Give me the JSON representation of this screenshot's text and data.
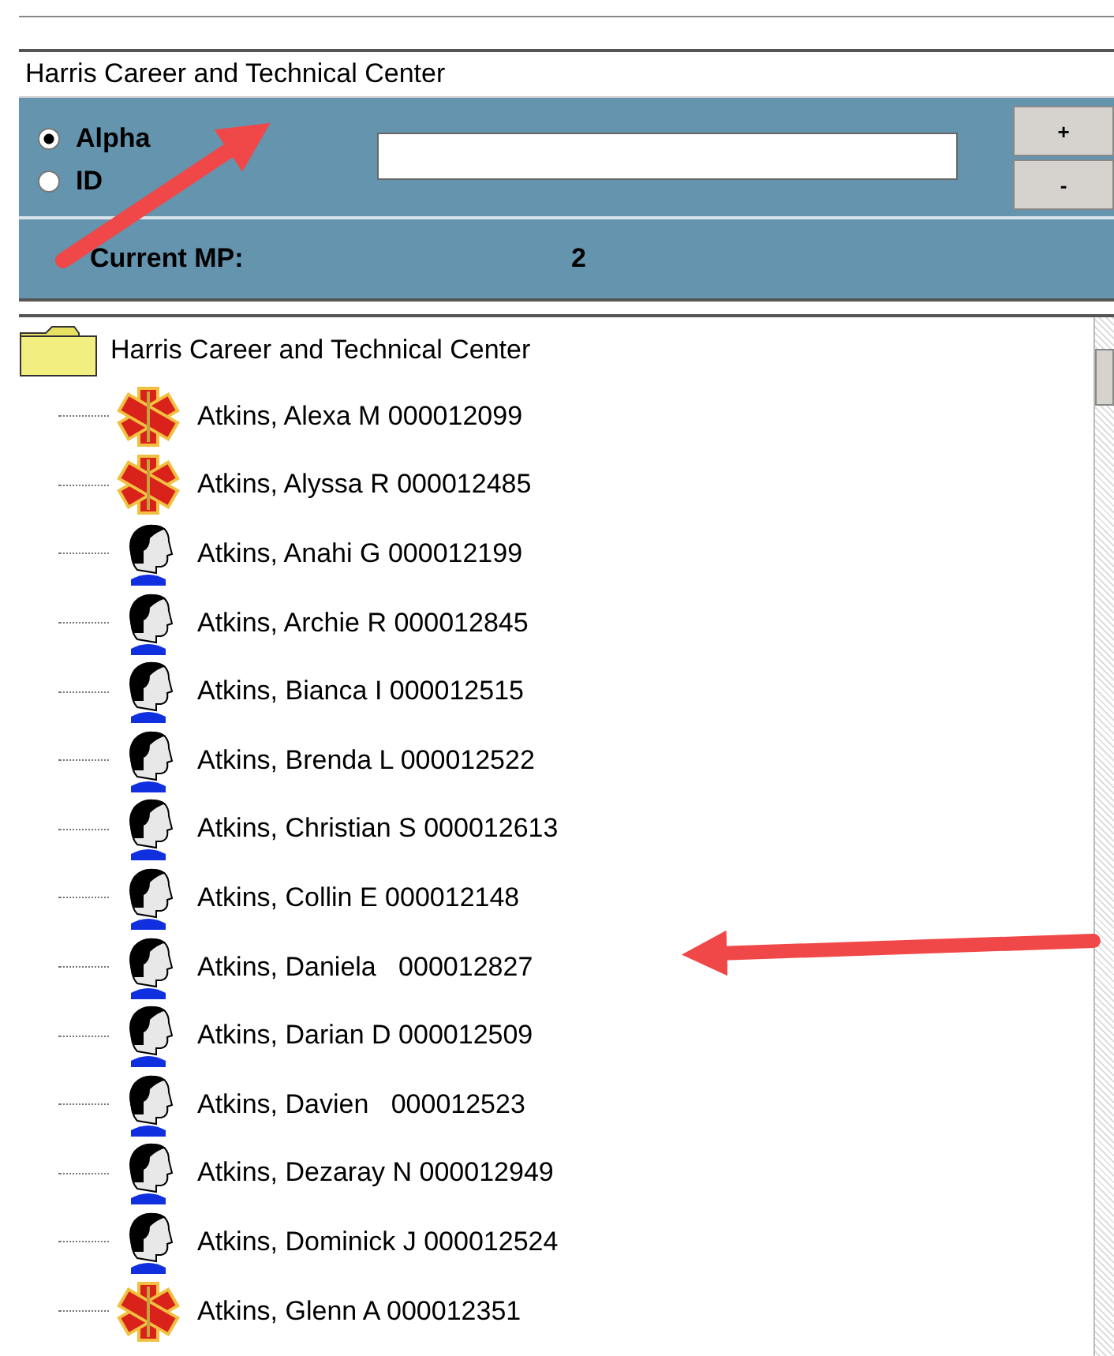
{
  "school_field": {
    "value": "Harris Career and Technical Center"
  },
  "search_mode": [
    {
      "label": "Alpha",
      "selected": true
    },
    {
      "label": "ID",
      "selected": false
    }
  ],
  "zoom_buttons": [
    "+",
    "-"
  ],
  "current_mp": {
    "label": "Current MP:",
    "value": "2"
  },
  "tree": {
    "label": "Harris Career and Technical Center",
    "expanded": true,
    "children": [
      {
        "label": "Atkins, Alexa M 000012099",
        "kind": "medical"
      },
      {
        "label": "Atkins, Alyssa R 000012485",
        "kind": "medical"
      },
      {
        "label": "Atkins, Anahi G 000012199",
        "kind": "student"
      },
      {
        "label": "Atkins, Archie R 000012845",
        "kind": "student"
      },
      {
        "label": "Atkins, Bianca I 000012515",
        "kind": "student"
      },
      {
        "label": "Atkins, Brenda L 000012522",
        "kind": "student"
      },
      {
        "label": "Atkins, Christian S 000012613",
        "kind": "student"
      },
      {
        "label": "Atkins, Collin E 000012148",
        "kind": "student"
      },
      {
        "label": "Atkins, Daniela   000012827",
        "kind": "student"
      },
      {
        "label": "Atkins, Darian D 000012509",
        "kind": "student"
      },
      {
        "label": "Atkins, Davien   000012523",
        "kind": "student"
      },
      {
        "label": "Atkins, Dezaray N 000012949",
        "kind": "student"
      },
      {
        "label": "Atkins, Dominick J 000012524",
        "kind": "student"
      },
      {
        "label": "Atkins, Glenn A 000012351",
        "kind": "medical"
      }
    ]
  }
}
